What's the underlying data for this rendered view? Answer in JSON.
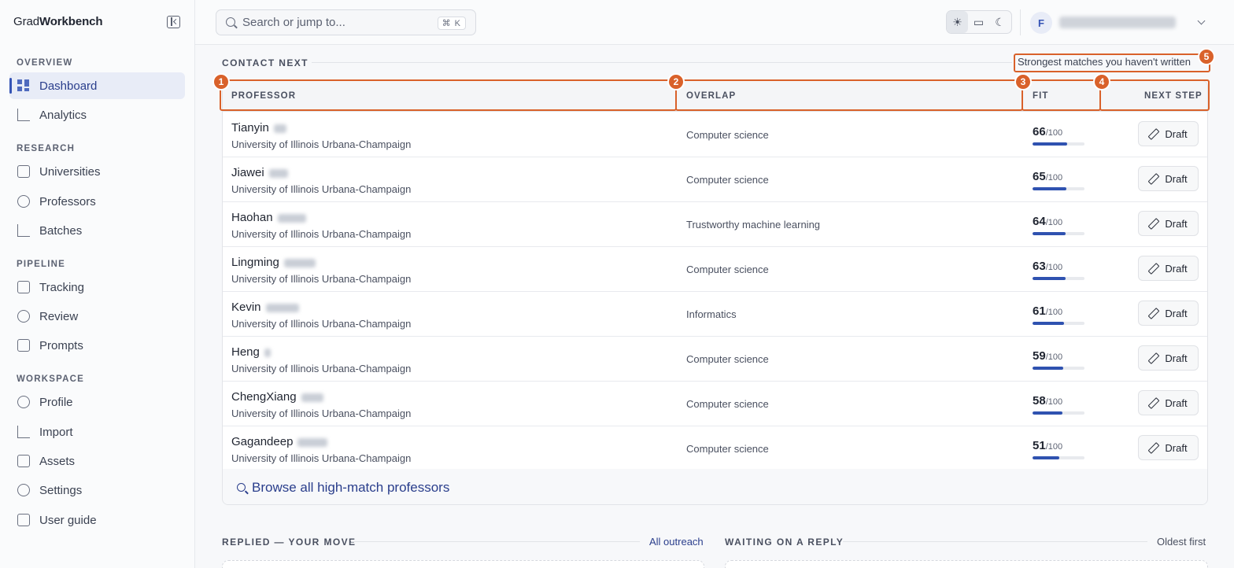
{
  "brand": {
    "prefix": "Grad",
    "bold": "Workbench"
  },
  "sidebar": {
    "sections": [
      {
        "label": "OVERVIEW",
        "items": [
          {
            "label": "Dashboard",
            "icon": "dashboard-icon",
            "active": true
          },
          {
            "label": "Analytics",
            "icon": "chart-icon"
          }
        ]
      },
      {
        "label": "RESEARCH",
        "items": [
          {
            "label": "Universities",
            "icon": "building-icon"
          },
          {
            "label": "Professors",
            "icon": "users-icon"
          },
          {
            "label": "Batches",
            "icon": "list-check-icon"
          }
        ]
      },
      {
        "label": "PIPELINE",
        "items": [
          {
            "label": "Tracking",
            "icon": "clipboard-icon"
          },
          {
            "label": "Review",
            "icon": "shield-icon"
          },
          {
            "label": "Prompts",
            "icon": "message-icon"
          }
        ]
      },
      {
        "label": "WORKSPACE",
        "items": [
          {
            "label": "Profile",
            "icon": "user-icon"
          },
          {
            "label": "Import",
            "icon": "upload-icon"
          },
          {
            "label": "Assets",
            "icon": "file-icon"
          },
          {
            "label": "Settings",
            "icon": "gear-icon"
          },
          {
            "label": "User guide",
            "icon": "book-icon"
          }
        ]
      }
    ]
  },
  "topbar": {
    "search_placeholder": "Search or jump to...",
    "shortcut": "⌘ K",
    "theme_icons": [
      "☀",
      "▭",
      "☾"
    ],
    "avatar_initial": "F"
  },
  "contact_next": {
    "title": "CONTACT NEXT",
    "hint": "Strongest matches you haven't written",
    "columns": {
      "professor": "PROFESSOR",
      "overlap": "OVERLAP",
      "fit": "FIT",
      "next_step": "NEXT STEP"
    },
    "rows": [
      {
        "first": "Tianyin",
        "university": "University of Illinois Urbana-Champaign",
        "overlap": "Computer science",
        "fit": "66",
        "fit_max": "/100",
        "fit_fraction": 0.66,
        "action": "Draft"
      },
      {
        "first": "Jiawei",
        "university": "University of Illinois Urbana-Champaign",
        "overlap": "Computer science",
        "fit": "65",
        "fit_max": "/100",
        "fit_fraction": 0.65,
        "action": "Draft"
      },
      {
        "first": "Haohan",
        "university": "University of Illinois Urbana-Champaign",
        "overlap": "Trustworthy machine learning",
        "fit": "64",
        "fit_max": "/100",
        "fit_fraction": 0.64,
        "action": "Draft"
      },
      {
        "first": "Lingming",
        "university": "University of Illinois Urbana-Champaign",
        "overlap": "Computer science",
        "fit": "63",
        "fit_max": "/100",
        "fit_fraction": 0.63,
        "action": "Draft"
      },
      {
        "first": "Kevin",
        "university": "University of Illinois Urbana-Champaign",
        "overlap": "Informatics",
        "fit": "61",
        "fit_max": "/100",
        "fit_fraction": 0.61,
        "action": "Draft"
      },
      {
        "first": "Heng",
        "university": "University of Illinois Urbana-Champaign",
        "overlap": "Computer science",
        "fit": "59",
        "fit_max": "/100",
        "fit_fraction": 0.59,
        "action": "Draft"
      },
      {
        "first": "ChengXiang",
        "university": "University of Illinois Urbana-Champaign",
        "overlap": "Computer science",
        "fit": "58",
        "fit_max": "/100",
        "fit_fraction": 0.58,
        "action": "Draft"
      },
      {
        "first": "Gagandeep",
        "university": "University of Illinois Urbana-Champaign",
        "overlap": "Computer science",
        "fit": "51",
        "fit_max": "/100",
        "fit_fraction": 0.51,
        "action": "Draft"
      }
    ],
    "browse_all": "Browse all high-match professors"
  },
  "replied": {
    "title": "REPLIED — YOUR MOVE",
    "link": "All outreach"
  },
  "waiting": {
    "title": "WAITING ON A REPLY",
    "sort": "Oldest first"
  },
  "annotations": [
    "1",
    "2",
    "3",
    "4",
    "5"
  ],
  "colors": {
    "accent": "#3554b5",
    "annotation": "#d9612a",
    "fit_bar": "#2f52b0"
  }
}
